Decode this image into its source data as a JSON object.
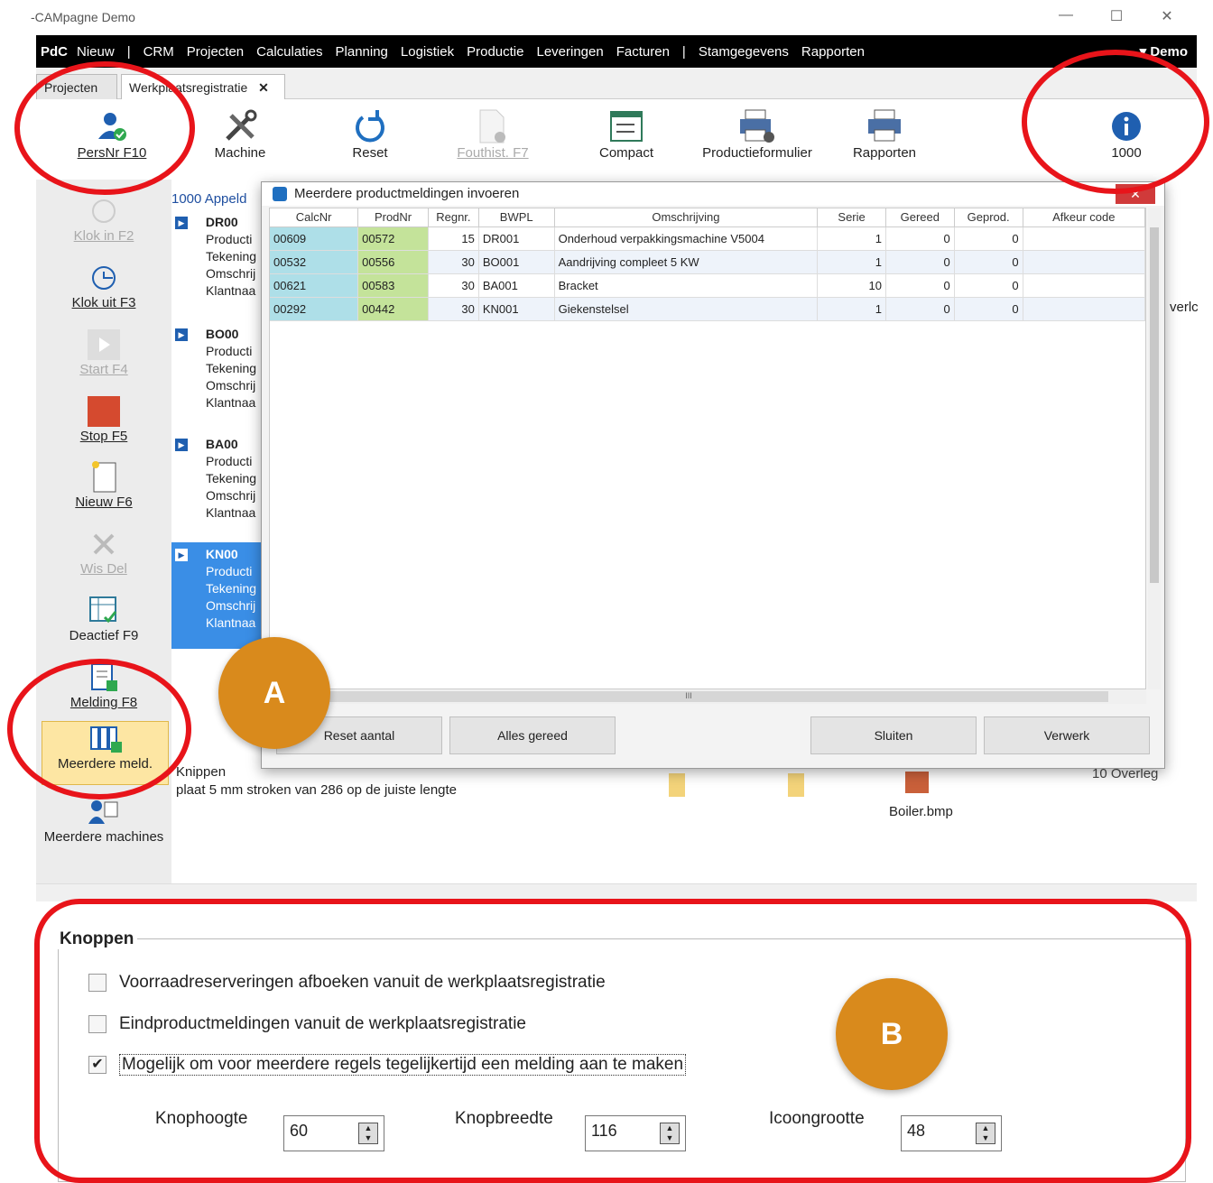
{
  "window": {
    "title": "-CAMpagne  Demo",
    "min": "—",
    "max": "☐",
    "close": "✕"
  },
  "menu": {
    "brand": "PdC",
    "items": [
      "Nieuw",
      "|",
      "CRM",
      "Projecten",
      "Calculaties",
      "Planning",
      "Logistiek",
      "Productie",
      "Leveringen",
      "Facturen",
      "|",
      "Stamgegevens",
      "Rapporten"
    ],
    "user": "▾ Demo"
  },
  "tabs": {
    "projecten": "Projecten",
    "werkplaats": "Werkplaatsregistratie",
    "close": "✕"
  },
  "toolbar": {
    "persnr": "PersNr F10",
    "machine": "Machine",
    "reset": "Reset",
    "fouthist": "Fouthist. F7",
    "compact": "Compact",
    "productieformulier": "Productieformulier",
    "rapporten": "Rapporten",
    "info": "1000"
  },
  "sidebar": {
    "klokin": "Klok in F2",
    "klokuit": "Klok uit F3",
    "start": "Start F4",
    "stop": "Stop F5",
    "nieuw": "Nieuw F6",
    "wisdel": "Wis Del",
    "deactief": "Deactief F9",
    "melding": "Melding F8",
    "meerdere": "Meerdere meld.",
    "machines": "Meerdere machines"
  },
  "list": {
    "header": "1000 Appeld",
    "items": [
      {
        "code": "DR00",
        "lines": [
          "Producti",
          "Tekening",
          "Omschrij",
          "Klantnaa"
        ]
      },
      {
        "code": "BO00",
        "lines": [
          "Producti",
          "Tekening",
          "Omschrij",
          "Klantnaa"
        ]
      },
      {
        "code": "BA00",
        "lines": [
          "Producti",
          "Tekening",
          "Omschrij",
          "Klantnaa"
        ]
      },
      {
        "code": "KN00",
        "lines": [
          "Producti",
          "Tekening",
          "Omschrij",
          "Klantnaa"
        ]
      }
    ]
  },
  "dialog": {
    "title": "Meerdere productmeldingen invoeren",
    "columns": [
      "CalcNr",
      "ProdNr",
      "Regnr.",
      "BWPL",
      "Omschrijving",
      "Serie",
      "Gereed",
      "Geprod.",
      "Afkeur code"
    ],
    "rows": [
      [
        "00609",
        "00572",
        "15",
        "DR001",
        "Onderhoud verpakkingsmachine V5004",
        "1",
        "0",
        "0",
        ""
      ],
      [
        "00532",
        "00556",
        "30",
        "BO001",
        "Aandrijving compleet 5 KW",
        "1",
        "0",
        "0",
        ""
      ],
      [
        "00621",
        "00583",
        "30",
        "BA001",
        "Bracket",
        "10",
        "0",
        "0",
        ""
      ],
      [
        "00292",
        "00442",
        "30",
        "KN001",
        "Giekenstelsel",
        "1",
        "0",
        "0",
        ""
      ]
    ],
    "buttons": {
      "reset": "Reset aantal",
      "alles": "Alles gereed",
      "sluiten": "Sluiten",
      "verwerk": "Verwerk"
    },
    "scroll_mark": "III"
  },
  "bottom": {
    "line1": "Knippen",
    "line2": "plaat 5 mm stroken van 286 op de juiste lengte",
    "file": "Boiler.bmp",
    "overleg": "10 Overleg",
    "overlc": "verlc"
  },
  "settings": {
    "section": "Knoppen",
    "options": [
      {
        "label": "Voorraadreserveringen afboeken vanuit de werkplaatsregistratie",
        "checked": false
      },
      {
        "label": "Eindproductmeldingen vanuit de werkplaatsregistratie",
        "checked": false
      },
      {
        "label": "Mogelijk om voor meerdere regels tegelijkertijd een melding aan te maken",
        "checked": true
      }
    ],
    "knophoogte_label": "Knophoogte",
    "knophoogte": "60",
    "knopbreedte_label": "Knopbreedte",
    "knopbreedte": "116",
    "icoongrootte_label": "Icoongrootte",
    "icoongrootte": "48"
  },
  "badges": {
    "a": "A",
    "b": "B"
  },
  "colors": {
    "accent_ring": "#e8141a",
    "badge": "#d98a1c",
    "calc_cell": "#aedfe8",
    "prod_cell": "#c4e39a",
    "selected": "#3a8ee6"
  }
}
